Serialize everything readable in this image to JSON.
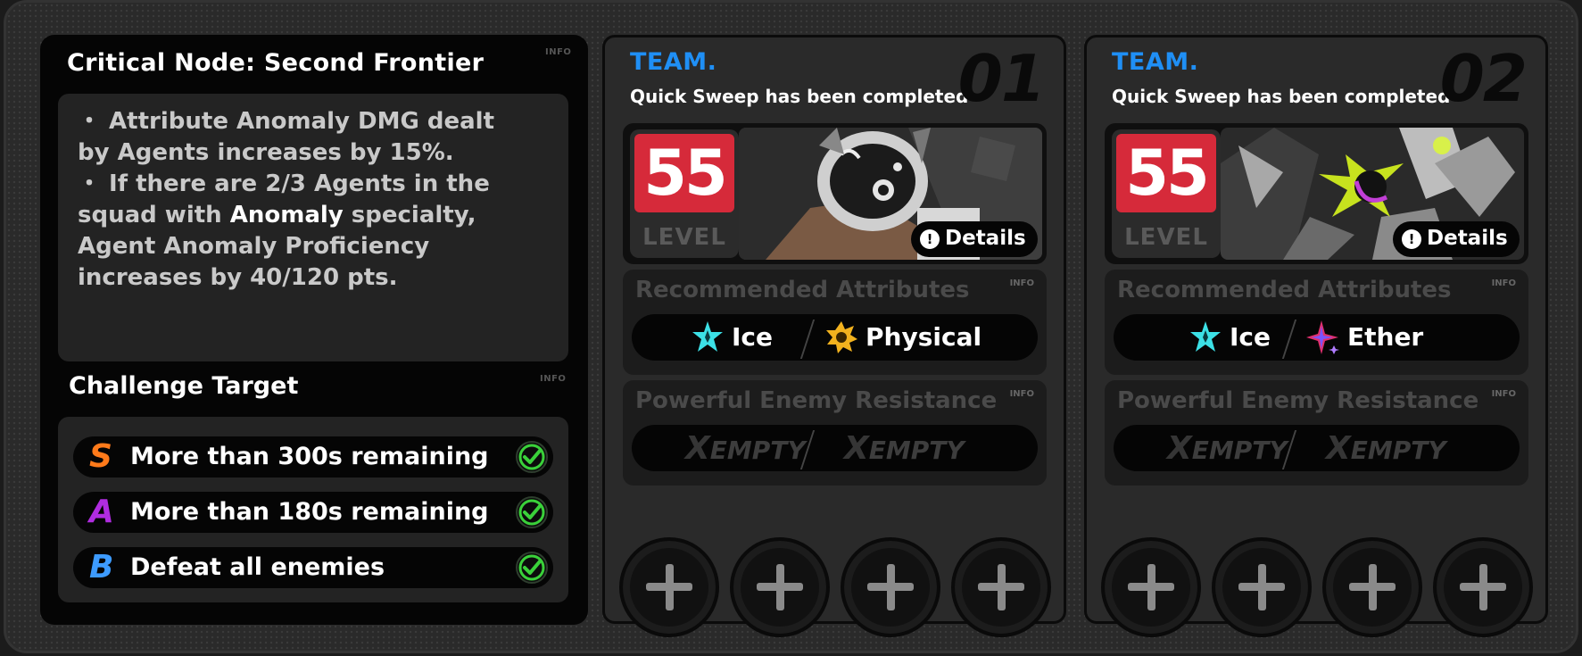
{
  "left_panel": {
    "title": "Critical Node: Second Frontier",
    "title_info": "INFO",
    "description_lines": [
      "・ Attribute Anomaly DMG dealt",
      "by Agents increases by 15%.",
      "・ If there are 2/3 Agents in the",
      "squad with ",
      "Anomaly",
      " specialty,",
      "Agent Anomaly Proficiency",
      "increases by 40/120 pts."
    ],
    "challenge_title": "Challenge Target",
    "challenge_info": "INFO",
    "targets": [
      {
        "grade": "S",
        "text": "More than 300s remaining",
        "completed": true,
        "grade_color": "#ff7a1a"
      },
      {
        "grade": "A",
        "text": "More than 180s remaining",
        "completed": true,
        "grade_color": "#b02ce0"
      },
      {
        "grade": "B",
        "text": "Defeat all enemies",
        "completed": true,
        "grade_color": "#3d9bff"
      }
    ]
  },
  "teams": [
    {
      "label": "TEAM.",
      "number": "01",
      "status": "Quick Sweep has been completed",
      "level": "55",
      "level_label": "LEVEL",
      "details_label": "Details",
      "recommended_title": "Recommended Attributes",
      "recommended_info": "INFO",
      "recommended": [
        {
          "icon": "ice-icon",
          "label": "Ice"
        },
        {
          "icon": "physical-icon",
          "label": "Physical"
        }
      ],
      "resistance_title": "Powerful Enemy Resistance",
      "resistance_info": "INFO",
      "resistance": [
        "EMPTY",
        "EMPTY"
      ],
      "empty_mark": "X",
      "slots": 4
    },
    {
      "label": "TEAM.",
      "number": "02",
      "status": "Quick Sweep has been completed",
      "level": "55",
      "level_label": "LEVEL",
      "details_label": "Details",
      "recommended_title": "Recommended Attributes",
      "recommended_info": "INFO",
      "recommended": [
        {
          "icon": "ice-icon",
          "label": "Ice"
        },
        {
          "icon": "ether-icon",
          "label": "Ether"
        }
      ],
      "resistance_title": "Powerful Enemy Resistance",
      "resistance_info": "INFO",
      "resistance": [
        "EMPTY",
        "EMPTY"
      ],
      "empty_mark": "X",
      "slots": 4
    }
  ],
  "colors": {
    "team_label": "#1f8ff5",
    "level_badge": "#d62a3a",
    "check": "#3ad13a",
    "ice": "#3ce0e6",
    "physical": "#f2b21e",
    "ether": "#e0306e"
  }
}
